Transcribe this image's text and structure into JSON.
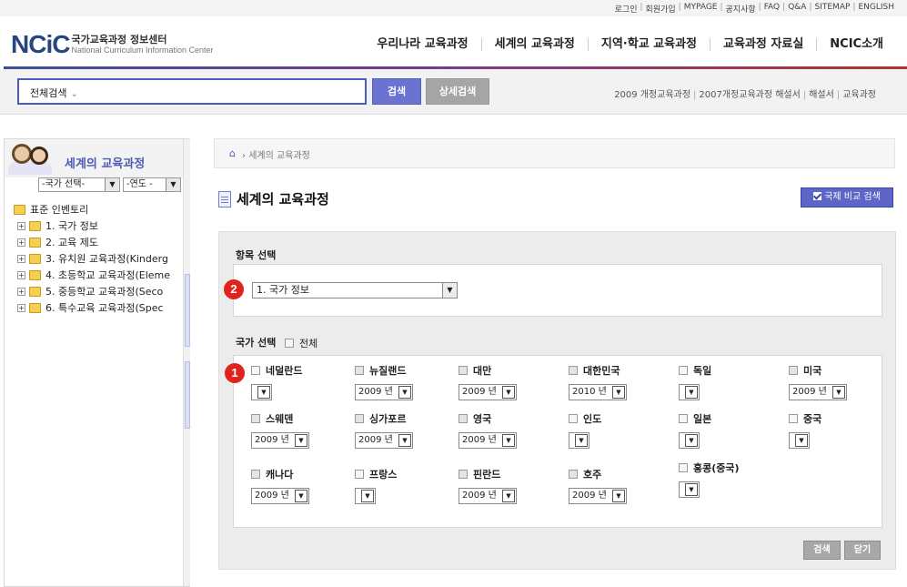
{
  "util_links": [
    "로그인",
    "회원가입",
    "MYPAGE",
    "공지사항",
    "FAQ",
    "Q&A",
    "SITEMAP",
    "ENGLISH"
  ],
  "logo": {
    "mark": "NCiC",
    "ko": "국가교육과정 정보센터",
    "en": "National Curriculum Information Center"
  },
  "gnb": [
    "우리나라 교육과정",
    "세계의 교육과정",
    "지역·학교 교육과정",
    "교육과정 자료실",
    "NCIC소개"
  ],
  "search": {
    "scope": "전체검색",
    "search_label": "검색",
    "advanced_label": "상세검색"
  },
  "quick_links": [
    "2009 개정교육과정",
    "2007개정교육과정 해설서",
    "해설서",
    "교육과정"
  ],
  "sidebar": {
    "title": "세계의 교육과정",
    "country_select": "-국가 선택-",
    "year_select": "-연도 -",
    "tree_root": "표준 인벤토리",
    "tree_items": [
      "1. 국가 정보",
      "2. 교육 제도",
      "3. 유치원 교육과정(Kinderg",
      "4. 초등학교 교육과정(Eleme",
      "5. 중등학교 교육과정(Seco",
      "6. 특수교육 교육과정(Spec"
    ]
  },
  "breadcrumb": {
    "current": "세계의 교육과정"
  },
  "page": {
    "title": "세계의 교육과정",
    "intl_button": "국제 비교 검색"
  },
  "form": {
    "item_label": "항목 선택",
    "item_value": "1. 국가 정보",
    "country_label": "국가 선택",
    "all_label": "전체",
    "badge_1": "1",
    "badge_2": "2",
    "countries": [
      {
        "name": "네덜란드",
        "year": ""
      },
      {
        "name": "뉴질랜드",
        "year": "2009 년"
      },
      {
        "name": "대만",
        "year": "2009 년"
      },
      {
        "name": "대한민국",
        "year": "2010 년"
      },
      {
        "name": "독일",
        "year": ""
      },
      {
        "name": "미국",
        "year": "2009 년"
      },
      {
        "name": "스웨덴",
        "year": "2009 년"
      },
      {
        "name": "싱가포르",
        "year": "2009 년"
      },
      {
        "name": "영국",
        "year": "2009 년"
      },
      {
        "name": "인도",
        "year": ""
      },
      {
        "name": "일본",
        "year": ""
      },
      {
        "name": "중국",
        "year": ""
      },
      {
        "name": "캐나다",
        "year": "2009 년"
      },
      {
        "name": "프랑스",
        "year": ""
      },
      {
        "name": "핀란드",
        "year": "2009 년"
      },
      {
        "name": "호주",
        "year": "2009 년"
      },
      {
        "name": "홍콩(중국)",
        "year": ""
      }
    ],
    "search_button": "검색",
    "close_button": "닫기"
  }
}
